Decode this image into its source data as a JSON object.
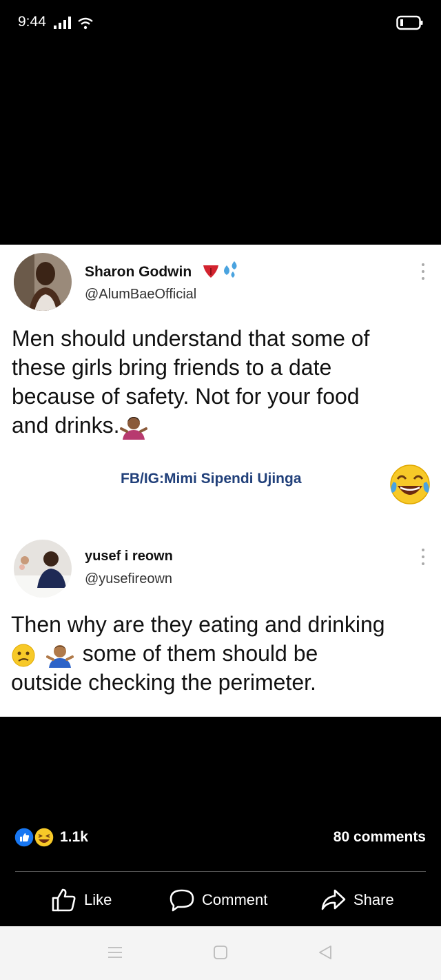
{
  "status_bar": {
    "time": "9:44",
    "icons": [
      "signal-icon",
      "wifi-icon",
      "battery-icon"
    ]
  },
  "tweets": [
    {
      "name": "Sharon Godwin",
      "name_emojis": [
        "tongue-emoji",
        "sweat-droplets-emoji"
      ],
      "handle": "@AlumBaeOfficial",
      "text_lines": [
        "Men should understand that some of",
        "these girls bring friends to a date",
        "because of safety. Not for your food",
        "and drinks."
      ],
      "trailing_emoji": "person-shrugging-emoji"
    },
    {
      "name": "yusef i reown",
      "handle": "@yusefireown",
      "text_lines": [
        "Then why are they eating and drinking",
        "some of them should be",
        "outside checking the perimeter."
      ],
      "inline_emojis": [
        "confused-face-emoji",
        "man-shrugging-emoji"
      ]
    }
  ],
  "watermark": "FB/IG:Mimi Sipendi Ujinga",
  "reactions": {
    "icons": [
      "like-reaction-icon",
      "haha-reaction-icon"
    ],
    "count": "1.1k",
    "comments": "80 comments"
  },
  "actions": {
    "like": "Like",
    "comment": "Comment",
    "share": "Share"
  },
  "nav_bar": [
    "menu-icon",
    "home-icon",
    "back-icon"
  ],
  "colors": {
    "background": "#000000",
    "card": "#ffffff",
    "watermark": "#21407a",
    "like_blue": "#1877f2",
    "haha_yellow": "#f7c928"
  }
}
